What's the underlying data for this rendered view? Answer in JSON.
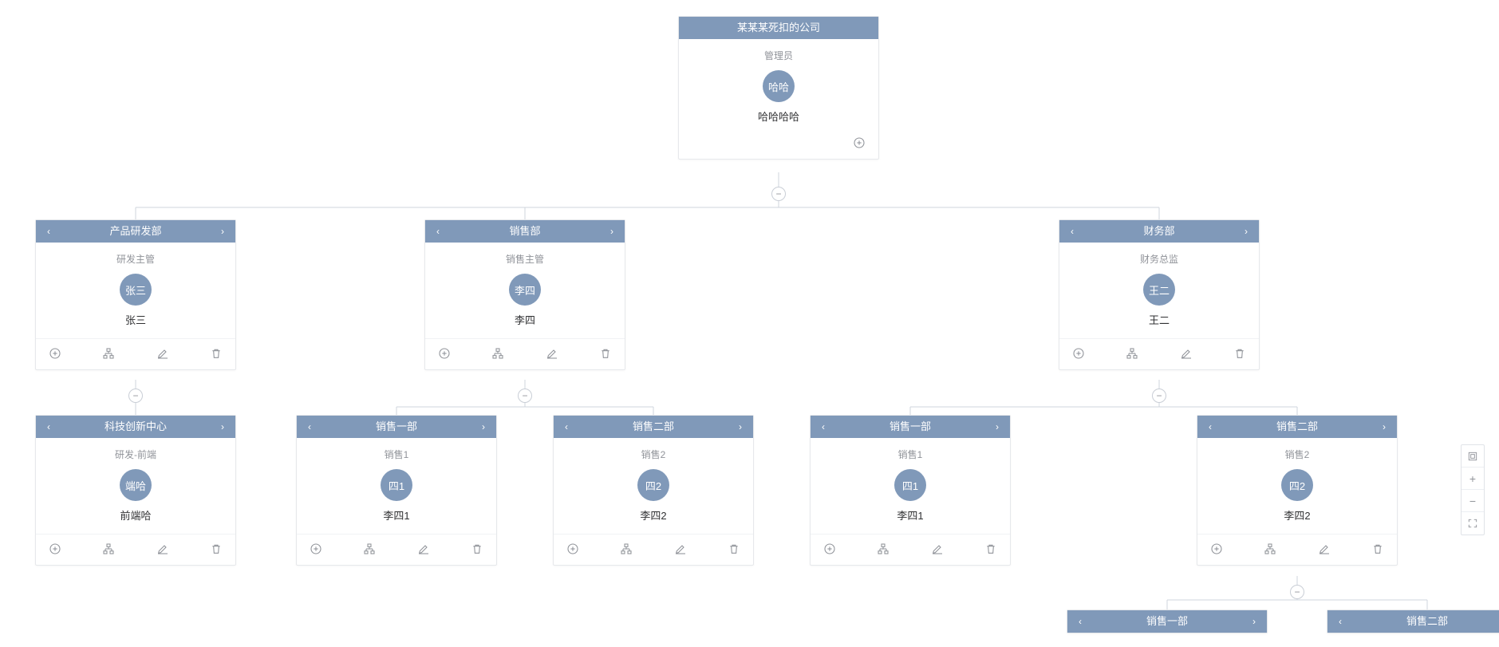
{
  "root": {
    "title": "某某某死扣的公司",
    "role": "管理员",
    "avatar": "哈哈",
    "name": "哈哈哈哈"
  },
  "level2": {
    "rd": {
      "title": "产品研发部",
      "role": "研发主管",
      "avatar": "张三",
      "name": "张三"
    },
    "sales": {
      "title": "销售部",
      "role": "销售主管",
      "avatar": "李四",
      "name": "李四"
    },
    "finance": {
      "title": "财务部",
      "role": "财务总监",
      "avatar": "王二",
      "name": "王二"
    }
  },
  "level3": {
    "tech": {
      "title": "科技创新中心",
      "role": "研发-前端",
      "avatar": "端哈",
      "name": "前端哈"
    },
    "s_a1": {
      "title": "销售一部",
      "role": "销售1",
      "avatar": "四1",
      "name": "李四1"
    },
    "s_a2": {
      "title": "销售二部",
      "role": "销售2",
      "avatar": "四2",
      "name": "李四2"
    },
    "s_b1": {
      "title": "销售一部",
      "role": "销售1",
      "avatar": "四1",
      "name": "李四1"
    },
    "s_b2": {
      "title": "销售二部",
      "role": "销售2",
      "avatar": "四2",
      "name": "李四2"
    }
  },
  "level4": {
    "c1": {
      "title": "销售一部"
    },
    "c2": {
      "title": "销售二部"
    }
  },
  "glyphs": {
    "minus": "−",
    "plus": "+",
    "chev_left": "‹",
    "chev_right": "›"
  }
}
